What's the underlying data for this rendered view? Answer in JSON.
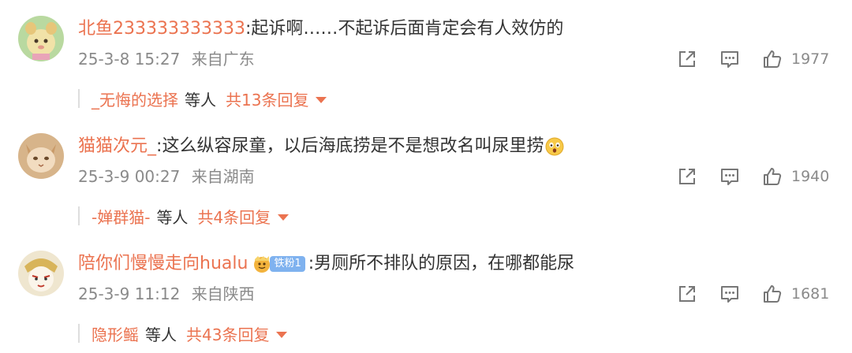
{
  "comments": [
    {
      "username": "北鱼233333333333",
      "colon": ":",
      "text": "起诉啊……不起诉后面肯定会有人效仿的",
      "time": "25-3-8 15:27",
      "location": "来自广东",
      "likes": "1977",
      "reply": {
        "user": "_无悔的选择",
        "etc": "等人",
        "count": "共13条回复"
      },
      "avatar_colors": {
        "bg": "#b9d9a0",
        "face": "#f1e2a8"
      }
    },
    {
      "username": "猫猫次元_",
      "colon": ":",
      "text": "这么纵容尿童，以后海底捞是不是想改名叫尿里捞",
      "emoji": "surprised-face",
      "time": "25-3-9 00:27",
      "location": "来自湖南",
      "likes": "1940",
      "reply": {
        "user": "-婵群猫-",
        "etc": "等人",
        "count": "共4条回复"
      },
      "avatar_colors": {
        "bg": "#d7b48a",
        "face": "#f2dcc0"
      }
    },
    {
      "username": "陪你们慢慢走向hualu",
      "badge": "铁粉1",
      "colon": ":",
      "text": "男厕所不排队的原因，在哪都能尿",
      "time": "25-3-9 11:12",
      "location": "来自陕西",
      "likes": "1681",
      "reply": {
        "user": "隐形鳐",
        "etc": "等人",
        "count": "共43条回复"
      },
      "avatar_colors": {
        "bg": "#efe6cf",
        "face": "#fbf5ea"
      }
    }
  ],
  "colors": {
    "accent": "#eb7350",
    "text": "#333333",
    "meta": "#8a8a8a",
    "badge": "#7fb2ef"
  },
  "icons": [
    "share-icon",
    "comment-icon",
    "like-icon",
    "dropdown-arrow-icon"
  ]
}
